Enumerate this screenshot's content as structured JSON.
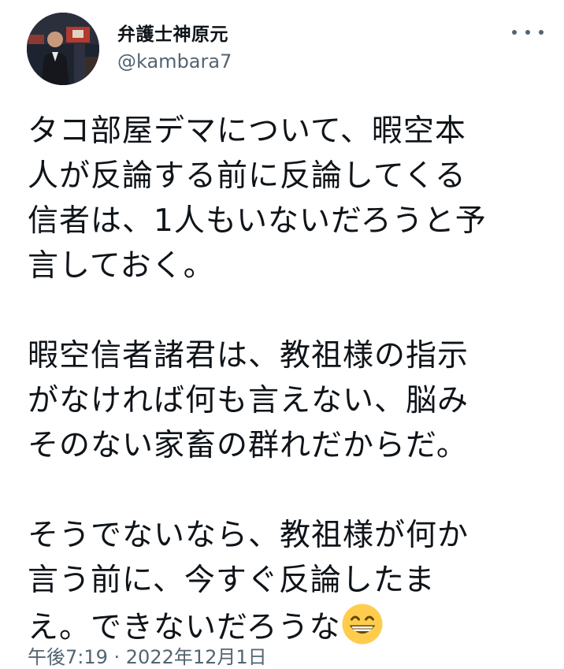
{
  "author": {
    "display_name": "弁護士神原元",
    "handle": "@kambara7"
  },
  "menu": {
    "icon": "more-horizontal-icon"
  },
  "tweet": {
    "lines": [
      "タコ部屋デマについて、暇空本",
      "人が反論する前に反論してくる",
      "信者は、1人もいないだろうと予",
      "言しておく。",
      "",
      "暇空信者諸君は、教祖様の指示",
      "がなければ何も言えない、脳み",
      "そのない家畜の群れだからだ。",
      "",
      "そうでないなら、教祖様が何か",
      "言う前に、今すぐ反論したま",
      "え。できないだろうな"
    ],
    "trailing_emoji": "grinning-face-with-smiling-eyes"
  },
  "meta": {
    "timestamp": "午後7:19 · 2022年12月1日"
  },
  "colors": {
    "text": "#0f1419",
    "secondary": "#536471",
    "background": "#ffffff"
  }
}
